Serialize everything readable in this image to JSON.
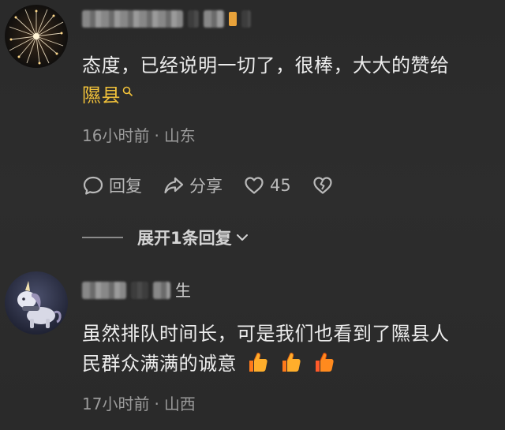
{
  "comments": [
    {
      "username_suffix": "",
      "text": "态度，已经说明一切了，很棒，大大的赞给",
      "link": "隰县",
      "time": "16小时前",
      "location": "山东",
      "actions": {
        "reply": "回复",
        "share": "分享",
        "likes": "45"
      },
      "expand_label": "展开1条回复"
    },
    {
      "username_suffix": "生",
      "text_line1": "虽然排队时间长，可是我们也看到了隰县人",
      "text_line2": "民群众满满的诚意",
      "emojis": [
        "thumbs-up",
        "thumbs-up",
        "thumbs-up"
      ],
      "time": "17小时前",
      "location": "山西"
    }
  ],
  "colors": {
    "background": "#2b2b2b",
    "text": "#ececec",
    "meta": "#9b9b9b",
    "link": "#f2c23a",
    "emoji": "#ff8a1e"
  },
  "icons": {
    "reply": "speech-bubble-icon",
    "share": "share-arrow-icon",
    "like": "heart-icon",
    "dislike": "broken-heart-icon",
    "expand": "chevron-down-icon",
    "link_search": "search-icon"
  }
}
